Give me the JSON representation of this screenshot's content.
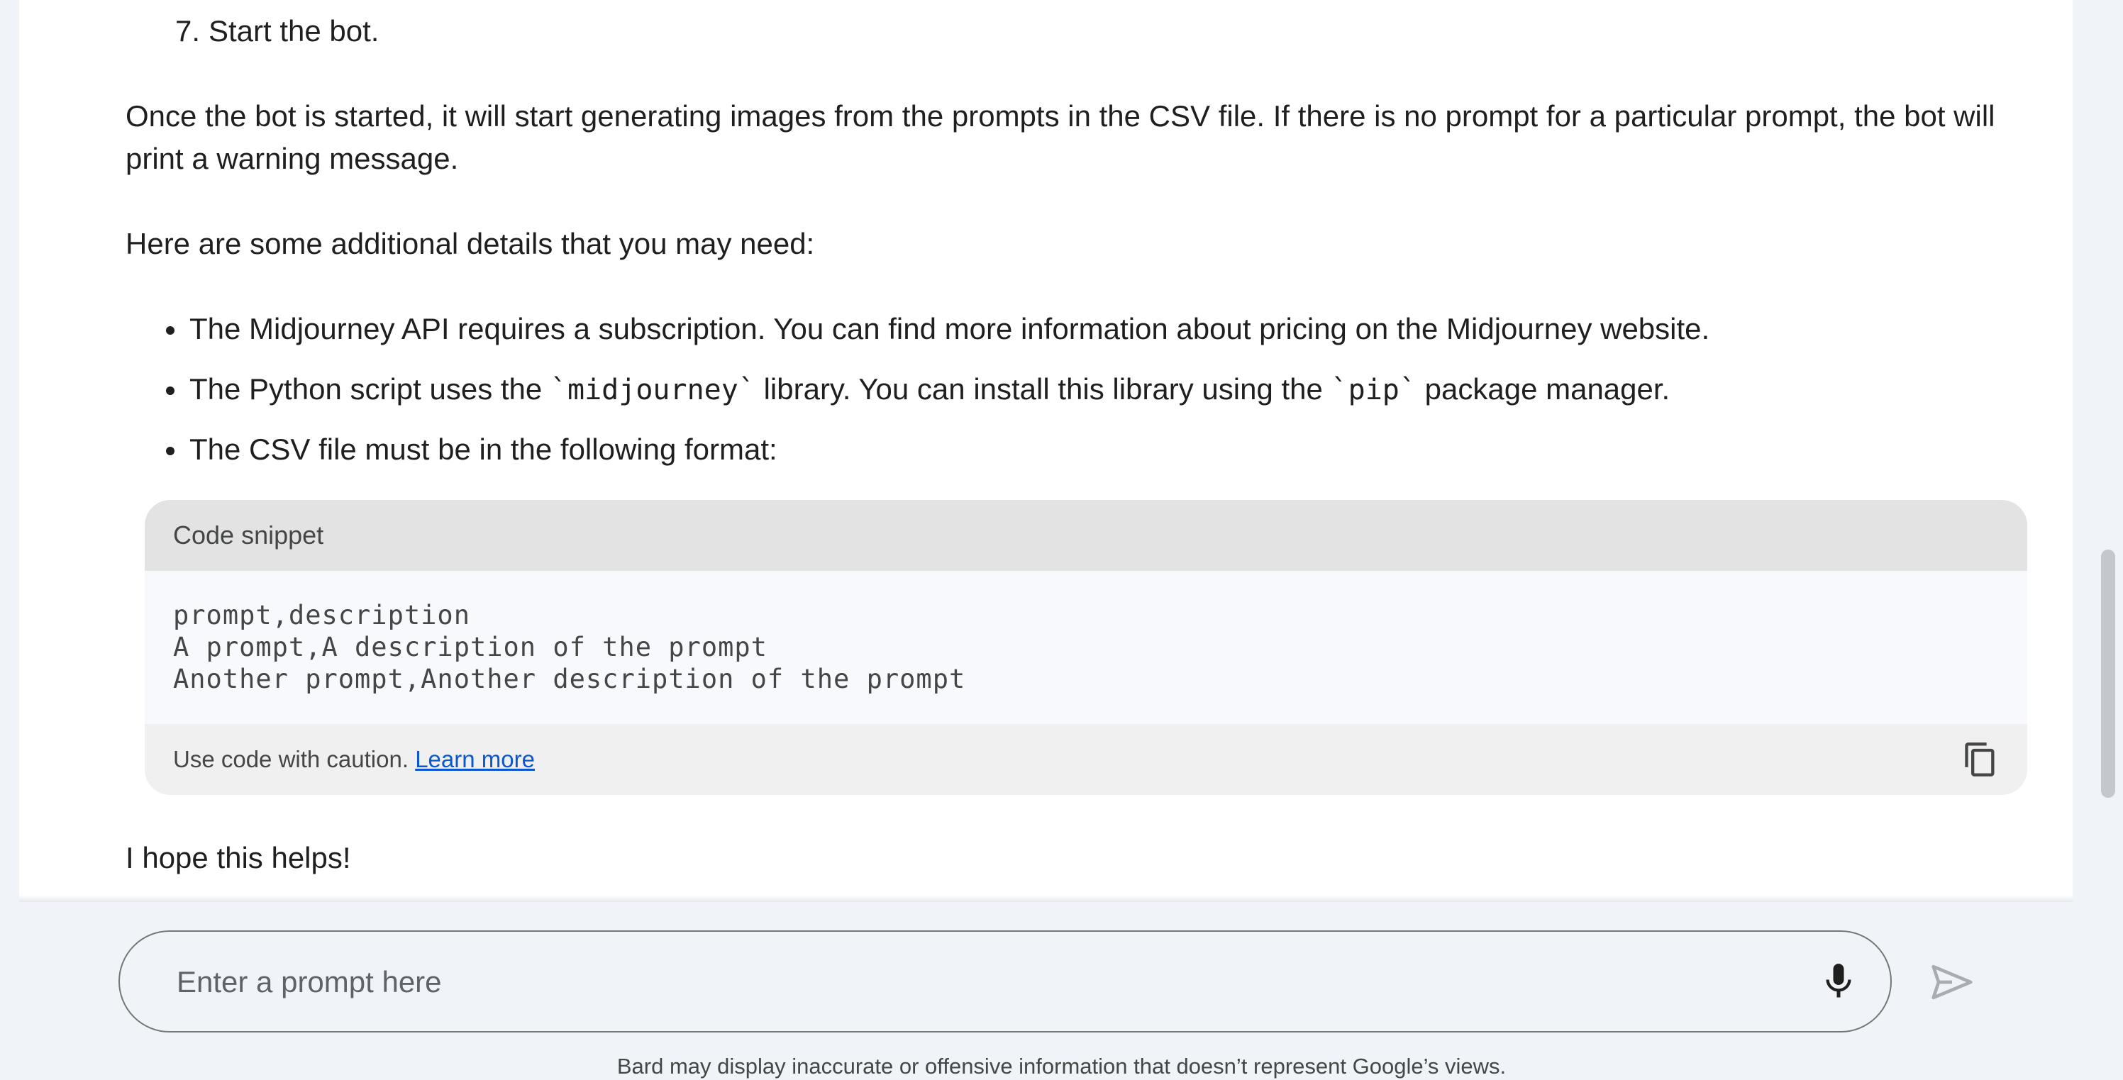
{
  "response": {
    "step": {
      "number": "7.",
      "text": "Start the bot."
    },
    "paragraph_1": "Once the bot is started, it will start generating images from the prompts in the CSV file. If there is no prompt for a particular prompt, the bot will print a warning message.",
    "paragraph_2": "Here are some additional details that you may need:",
    "bullets": [
      {
        "text": "The Midjourney API requires a subscription. You can find more information about pricing on the Midjourney website."
      },
      {
        "before": "The Python script uses the ",
        "code_1": "`midjourney`",
        "middle": " library. You can install this library using the ",
        "code_2": "`pip`",
        "after": " package manager."
      },
      {
        "text": "The CSV file must be in the following format:"
      }
    ],
    "code_block": {
      "header": "Code snippet",
      "lines": [
        "prompt,description",
        "A prompt,A description of the prompt",
        "Another prompt,Another description of the prompt"
      ],
      "caution": "Use code with caution. ",
      "learn_more": "Learn more",
      "copy_icon": "copy-icon"
    },
    "closing": "I hope this helps!"
  },
  "input": {
    "placeholder": "Enter a prompt here",
    "mic_icon": "mic-icon",
    "send_icon": "send-icon"
  },
  "disclaimer": "Bard may display inaccurate or offensive information that doesn’t represent Google’s views.",
  "colors": {
    "background": "#f0f4f9",
    "panel": "#ffffff",
    "text": "#1f1f1f",
    "link": "#0b57d0",
    "code_header": "#e3e3e3"
  }
}
